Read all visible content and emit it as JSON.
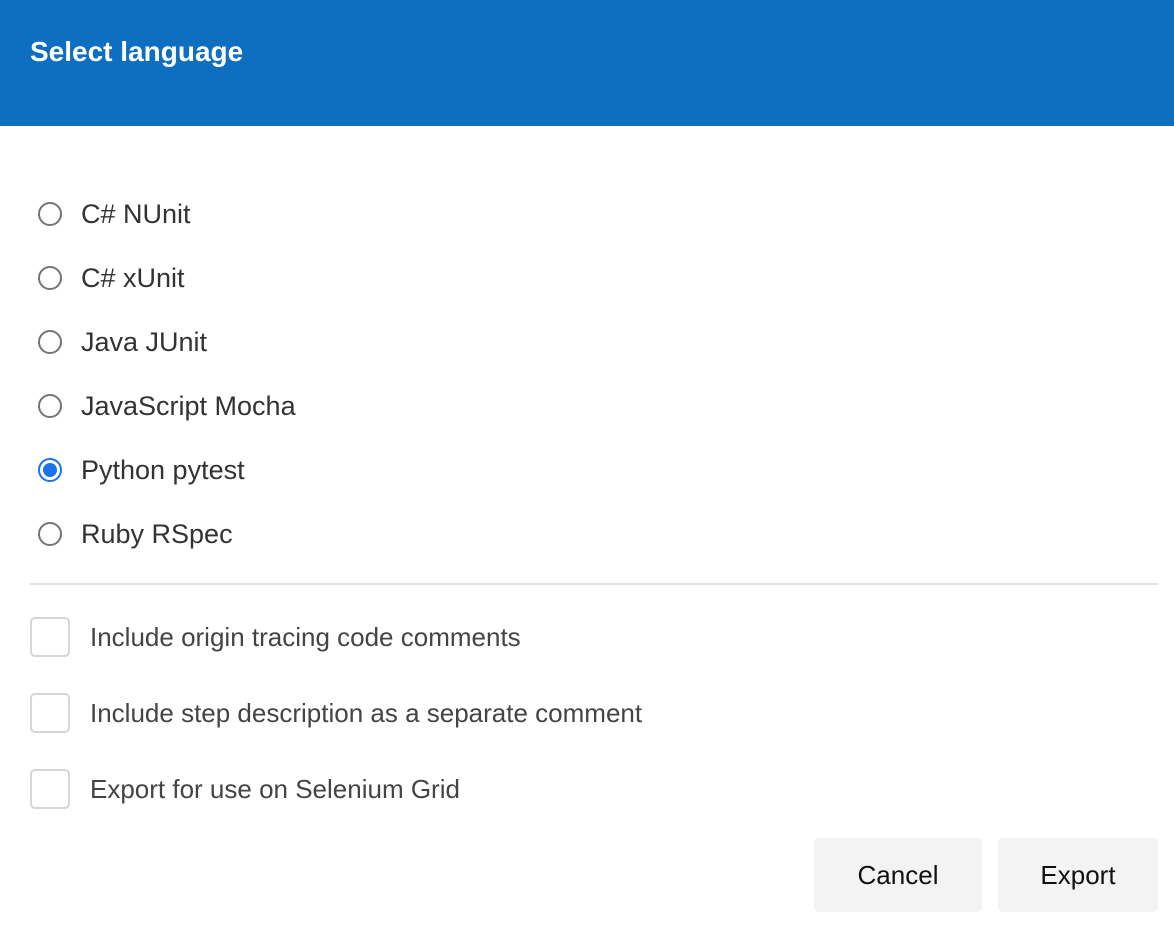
{
  "dialog": {
    "title": "Select language",
    "header_color": "#0e6ebf"
  },
  "languages": [
    {
      "label": "C# NUnit",
      "selected": false
    },
    {
      "label": "C# xUnit",
      "selected": false
    },
    {
      "label": "Java JUnit",
      "selected": false
    },
    {
      "label": "JavaScript Mocha",
      "selected": false
    },
    {
      "label": "Python pytest",
      "selected": true
    },
    {
      "label": "Ruby RSpec",
      "selected": false
    }
  ],
  "options": [
    {
      "label": "Include origin tracing code comments",
      "checked": false
    },
    {
      "label": "Include step description as a separate comment",
      "checked": false
    },
    {
      "label": "Export for use on Selenium Grid",
      "checked": false
    }
  ],
  "buttons": {
    "cancel_label": "Cancel",
    "export_label": "Export"
  },
  "accent_color": "#1a73e8"
}
